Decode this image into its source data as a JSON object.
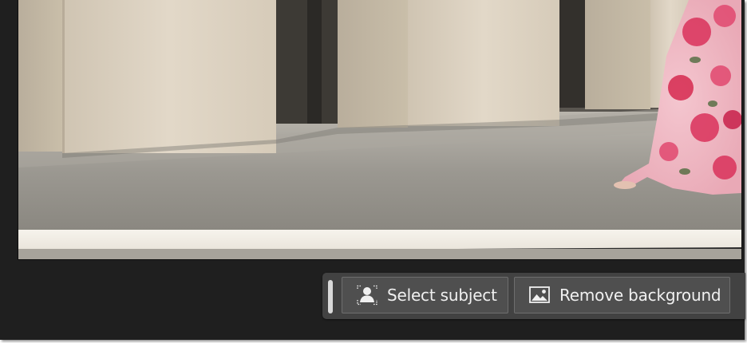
{
  "contextual_taskbar": {
    "buttons": [
      {
        "label": "Select subject",
        "icon": "select-subject-icon"
      },
      {
        "label": "Remove background",
        "icon": "image-icon"
      }
    ]
  },
  "colors": {
    "frame_background": "#1f1f1f",
    "taskbar_background": "#424242",
    "button_background": "#4f4f4f",
    "button_border": "#6e6e6e",
    "button_text": "#f0f0f0"
  }
}
